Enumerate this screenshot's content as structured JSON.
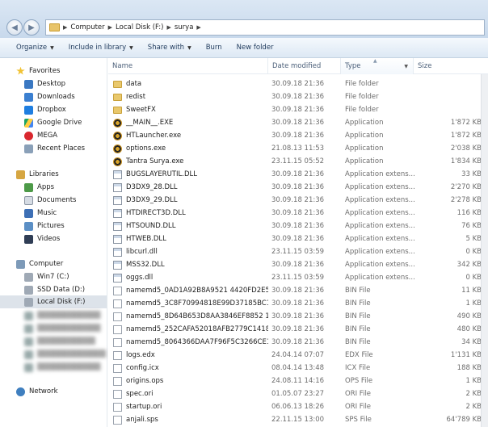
{
  "address": {
    "segments": [
      "Computer",
      "Local Disk (F:)",
      "surya"
    ]
  },
  "toolbar": {
    "organize": "Organize",
    "include": "Include in library",
    "share": "Share with",
    "burn": "Burn",
    "new_folder": "New folder"
  },
  "sidebar": {
    "favorites": "Favorites",
    "desktop": "Desktop",
    "downloads": "Downloads",
    "dropbox": "Dropbox",
    "google_drive": "Google Drive",
    "mega": "MEGA",
    "recent": "Recent Places",
    "libraries": "Libraries",
    "apps": "Apps",
    "documents": "Documents",
    "music": "Music",
    "pictures": "Pictures",
    "videos": "Videos",
    "computer": "Computer",
    "win7": "Win7 (C:)",
    "ssd": "SSD Data (D:)",
    "local_disk": "Local Disk (F:)",
    "network": "Network"
  },
  "columns": {
    "name": "Name",
    "date": "Date modified",
    "type": "Type",
    "size": "Size"
  },
  "files": [
    {
      "name": "data",
      "date": "30.09.18 21:36",
      "type": "File folder",
      "size": "",
      "icon": "folder"
    },
    {
      "name": "redist",
      "date": "30.09.18 21:36",
      "type": "File folder",
      "size": "",
      "icon": "folder"
    },
    {
      "name": "SweetFX",
      "date": "30.09.18 21:36",
      "type": "File folder",
      "size": "",
      "icon": "folder"
    },
    {
      "name": "__MAIN__.EXE",
      "date": "30.09.18 21:36",
      "type": "Application",
      "size": "1'872 KB",
      "icon": "app"
    },
    {
      "name": "HTLauncher.exe",
      "date": "30.09.18 21:36",
      "type": "Application",
      "size": "1'872 KB",
      "icon": "app"
    },
    {
      "name": "options.exe",
      "date": "21.08.13 11:53",
      "type": "Application",
      "size": "2'038 KB",
      "icon": "app"
    },
    {
      "name": "Tantra Surya.exe",
      "date": "23.11.15 05:52",
      "type": "Application",
      "size": "1'834 KB",
      "icon": "app"
    },
    {
      "name": "BUGSLAYERUTIL.DLL",
      "date": "30.09.18 21:36",
      "type": "Application extens...",
      "size": "33 KB",
      "icon": "dll"
    },
    {
      "name": "D3DX9_28.DLL",
      "date": "30.09.18 21:36",
      "type": "Application extens...",
      "size": "2'270 KB",
      "icon": "dll"
    },
    {
      "name": "D3DX9_29.DLL",
      "date": "30.09.18 21:36",
      "type": "Application extens...",
      "size": "2'278 KB",
      "icon": "dll"
    },
    {
      "name": "HTDIRECT3D.DLL",
      "date": "30.09.18 21:36",
      "type": "Application extens...",
      "size": "116 KB",
      "icon": "dll"
    },
    {
      "name": "HTSOUND.DLL",
      "date": "30.09.18 21:36",
      "type": "Application extens...",
      "size": "76 KB",
      "icon": "dll"
    },
    {
      "name": "HTWEB.DLL",
      "date": "30.09.18 21:36",
      "type": "Application extens...",
      "size": "5 KB",
      "icon": "dll"
    },
    {
      "name": "libcurl.dll",
      "date": "23.11.15 03:59",
      "type": "Application extens...",
      "size": "0 KB",
      "icon": "dll"
    },
    {
      "name": "MSS32.DLL",
      "date": "30.09.18 21:36",
      "type": "Application extens...",
      "size": "342 KB",
      "icon": "dll"
    },
    {
      "name": "oggs.dll",
      "date": "23.11.15 03:59",
      "type": "Application extens...",
      "size": "0 KB",
      "icon": "dll"
    },
    {
      "name": "namemd5_0AD1A92B8A9521 4420FD2E56...",
      "date": "30.09.18 21:36",
      "type": "BIN File",
      "size": "11 KB",
      "icon": "file"
    },
    {
      "name": "namemd5_3C8F70994818E99D37185BC1E...",
      "date": "30.09.18 21:36",
      "type": "BIN File",
      "size": "1 KB",
      "icon": "file"
    },
    {
      "name": "namemd5_8D64B653D8AA3846EF8852 1B...",
      "date": "30.09.18 21:36",
      "type": "BIN File",
      "size": "490 KB",
      "icon": "file"
    },
    {
      "name": "namemd5_252CAFA52018AFB2779C1418...",
      "date": "30.09.18 21:36",
      "type": "BIN File",
      "size": "480 KB",
      "icon": "file"
    },
    {
      "name": "namemd5_8064366DAA7F96F5C3266CE1...",
      "date": "30.09.18 21:36",
      "type": "BIN File",
      "size": "34 KB",
      "icon": "file"
    },
    {
      "name": "logs.edx",
      "date": "24.04.14 07:07",
      "type": "EDX File",
      "size": "1'131 KB",
      "icon": "file"
    },
    {
      "name": "config.icx",
      "date": "08.04.14 13:48",
      "type": "ICX File",
      "size": "188 KB",
      "icon": "file"
    },
    {
      "name": "origins.ops",
      "date": "24.08.11 14:16",
      "type": "OPS File",
      "size": "1 KB",
      "icon": "file"
    },
    {
      "name": "spec.ori",
      "date": "01.05.07 23:27",
      "type": "ORI File",
      "size": "2 KB",
      "icon": "file"
    },
    {
      "name": "startup.ori",
      "date": "06.06.13 18:26",
      "type": "ORI File",
      "size": "2 KB",
      "icon": "file"
    },
    {
      "name": "anjali.sps",
      "date": "22.11.15 13:00",
      "type": "SPS File",
      "size": "64'789 KB",
      "icon": "file"
    }
  ]
}
